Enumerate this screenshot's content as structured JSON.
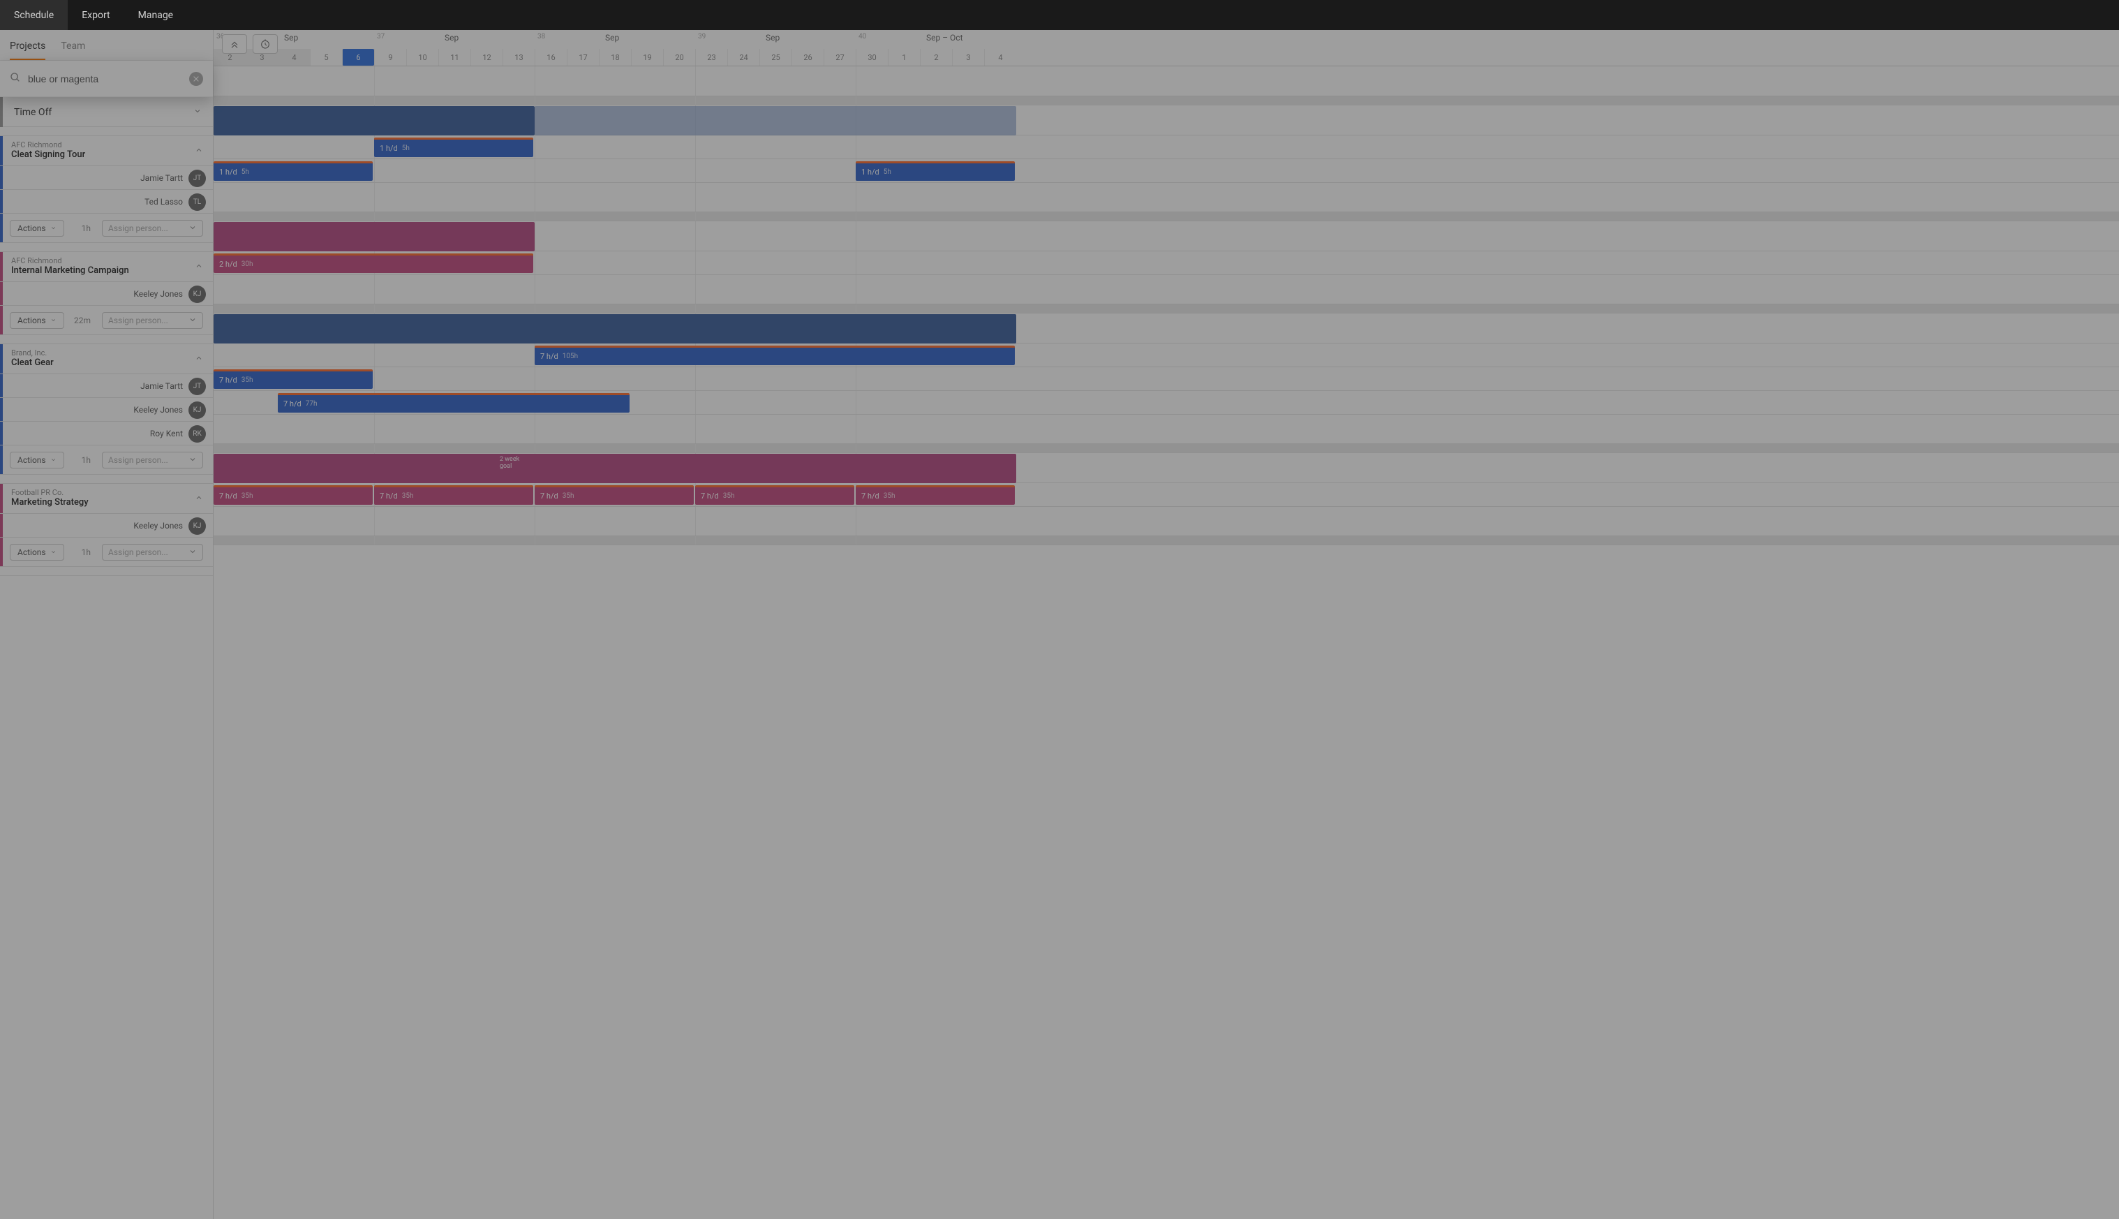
{
  "topnav": {
    "schedule": "Schedule",
    "export": "Export",
    "manage": "Manage"
  },
  "side_tabs": {
    "projects": "Projects",
    "team": "Team"
  },
  "search": {
    "value": "blue or magenta"
  },
  "timeoff": {
    "label": "Time Off"
  },
  "actions_label": "Actions",
  "assign_placeholder": "Assign person...",
  "budgets": {
    "p0": "1h",
    "p1": "22m",
    "p2": "1h",
    "p3": "1h"
  },
  "goal_tag": {
    "line1": "2 week",
    "line2": "goal"
  },
  "projects": [
    {
      "client": "AFC Richmond",
      "name": "Cleat Signing Tour",
      "color": "blue",
      "people": [
        {
          "name": "Jamie Tartt",
          "initials": "JT"
        },
        {
          "name": "Ted Lasso",
          "initials": "TL"
        }
      ],
      "allocs": [
        {
          "person": 0,
          "rate": "1 h/d",
          "hrs": "5h",
          "start": 5,
          "span": 5
        },
        {
          "person": 1,
          "rate": "1 h/d",
          "hrs": "5h",
          "start": 0,
          "span": 5
        },
        {
          "person": 1,
          "rate": "1 h/d",
          "hrs": "5h",
          "start": 20,
          "span": 5
        }
      ],
      "bar": {
        "solid_span": 10,
        "light_span": 20
      }
    },
    {
      "client": "AFC Richmond",
      "name": "Internal Marketing Campaign",
      "color": "mag",
      "people": [
        {
          "name": "Keeley Jones",
          "initials": "KJ"
        }
      ],
      "allocs": [
        {
          "person": 0,
          "rate": "2 h/d",
          "hrs": "30h",
          "start": 0,
          "span": 10
        }
      ],
      "bar": {
        "solid_span": 10
      }
    },
    {
      "client": "Brand, Inc.",
      "name": "Cleat Gear",
      "color": "blue",
      "people": [
        {
          "name": "Jamie Tartt",
          "initials": "JT"
        },
        {
          "name": "Keeley Jones",
          "initials": "KJ"
        },
        {
          "name": "Roy Kent",
          "initials": "RK"
        }
      ],
      "allocs": [
        {
          "person": 0,
          "rate": "7 h/d",
          "hrs": "105h",
          "start": 10,
          "span": 15
        },
        {
          "person": 1,
          "rate": "7 h/d",
          "hrs": "35h",
          "start": 0,
          "span": 5
        },
        {
          "person": 2,
          "rate": "7 h/d",
          "hrs": "77h",
          "start": 2,
          "span": 11
        }
      ],
      "bar": {
        "solid_span": 25
      }
    },
    {
      "client": "Football PR Co.",
      "name": "Marketing Strategy",
      "color": "mag",
      "people": [
        {
          "name": "Keeley Jones",
          "initials": "KJ"
        }
      ],
      "allocs": [
        {
          "person": 0,
          "rate": "7 h/d",
          "hrs": "35h",
          "start": 0,
          "span": 5
        },
        {
          "person": 0,
          "rate": "7 h/d",
          "hrs": "35h",
          "start": 5,
          "span": 5
        },
        {
          "person": 0,
          "rate": "7 h/d",
          "hrs": "35h",
          "start": 10,
          "span": 5
        },
        {
          "person": 0,
          "rate": "7 h/d",
          "hrs": "35h",
          "start": 15,
          "span": 5
        },
        {
          "person": 0,
          "rate": "7 h/d",
          "hrs": "35h",
          "start": 20,
          "span": 5
        }
      ],
      "bar": {
        "solid_span": 25,
        "goal_at": 9
      }
    }
  ],
  "calendar": {
    "today_index": 4,
    "past_days": 3,
    "weeks": [
      {
        "wn": "36",
        "month": "Sep",
        "days": [
          "2",
          "3",
          "4",
          "5",
          "6"
        ]
      },
      {
        "wn": "37",
        "month": "Sep",
        "days": [
          "9",
          "10",
          "11",
          "12",
          "13"
        ]
      },
      {
        "wn": "38",
        "month": "Sep",
        "days": [
          "16",
          "17",
          "18",
          "19",
          "20"
        ]
      },
      {
        "wn": "39",
        "month": "Sep",
        "days": [
          "23",
          "24",
          "25",
          "26",
          "27"
        ]
      },
      {
        "wn": "40",
        "month": "Sep – Oct",
        "days": [
          "30",
          "1",
          "2",
          "3",
          "4"
        ]
      }
    ]
  }
}
